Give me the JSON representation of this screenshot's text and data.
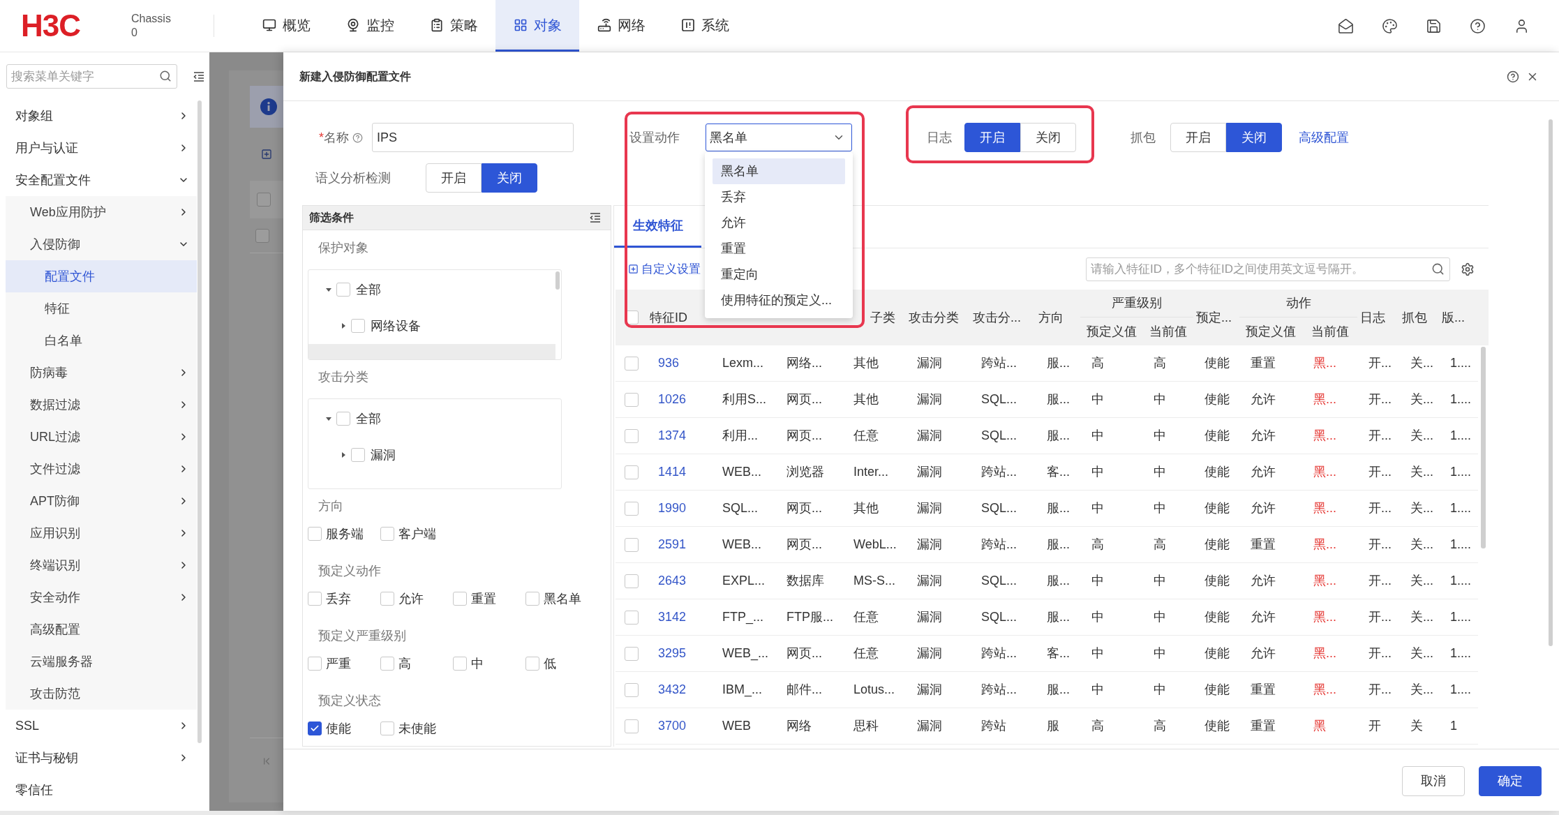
{
  "header": {
    "logo": "H3C",
    "device": {
      "name": "Chassis",
      "slot": "0"
    },
    "nav": [
      {
        "label": "概览",
        "selected": false
      },
      {
        "label": "监控",
        "selected": false
      },
      {
        "label": "策略",
        "selected": false
      },
      {
        "label": "对象",
        "selected": true
      },
      {
        "label": "网络",
        "selected": false
      },
      {
        "label": "系统",
        "selected": false
      }
    ]
  },
  "sidebar": {
    "search": {
      "placeholder": "搜索菜单关键字"
    },
    "items": [
      {
        "label": "对象组",
        "expanded": false,
        "selected": false
      },
      {
        "label": "用户与认证",
        "expanded": false,
        "selected": false
      },
      {
        "label": "安全配置文件",
        "expanded": true,
        "selected": false,
        "children": [
          {
            "label": "Web应用防护",
            "expanded": false,
            "selected": false
          },
          {
            "label": "入侵防御",
            "expanded": true,
            "selected": false,
            "children": [
              {
                "label": "配置文件",
                "selected": true
              },
              {
                "label": "特征",
                "selected": false
              },
              {
                "label": "白名单",
                "selected": false
              }
            ]
          },
          {
            "label": "防病毒",
            "expanded": false,
            "selected": false
          },
          {
            "label": "数据过滤",
            "expanded": false,
            "selected": false
          },
          {
            "label": "URL过滤",
            "expanded": false,
            "selected": false
          },
          {
            "label": "文件过滤",
            "expanded": false,
            "selected": false
          },
          {
            "label": "APT防御",
            "expanded": false,
            "selected": false
          },
          {
            "label": "应用识别",
            "expanded": false,
            "selected": false
          },
          {
            "label": "终端识别",
            "expanded": false,
            "selected": false
          },
          {
            "label": "安全动作",
            "expanded": false,
            "selected": false
          },
          {
            "label": "高级配置",
            "selected": false
          },
          {
            "label": "云端服务器",
            "selected": false
          },
          {
            "label": "攻击防范",
            "selected": false
          }
        ]
      },
      {
        "label": "SSL",
        "expanded": false,
        "selected": false
      },
      {
        "label": "证书与秘钥",
        "expanded": false,
        "selected": false
      },
      {
        "label": "零信任",
        "selected": false
      }
    ]
  },
  "background_page": {
    "rows": [
      {
        "checked": false
      },
      {
        "checked": false
      }
    ]
  },
  "dialog": {
    "title": "新建入侵防御配置文件",
    "name_field": {
      "required_mark": "*",
      "label": "名称",
      "value": "IPS"
    },
    "semantic_detection": {
      "label": "语义分析检测",
      "options": [
        {
          "label": "开启",
          "selected": false
        },
        {
          "label": "关闭",
          "selected": true
        }
      ]
    },
    "action_select": {
      "label": "设置动作",
      "value": "黑名单",
      "expanded": true,
      "options": [
        {
          "label": "黑名单",
          "selected": true
        },
        {
          "label": "丢弃",
          "selected": false
        },
        {
          "label": "允许",
          "selected": false
        },
        {
          "label": "重置",
          "selected": false
        },
        {
          "label": "重定向",
          "selected": false
        },
        {
          "label": "使用特征的预定义...",
          "selected": false
        }
      ]
    },
    "log": {
      "label": "日志",
      "options": [
        {
          "label": "开启",
          "selected": true
        },
        {
          "label": "关闭",
          "selected": false
        }
      ]
    },
    "capture": {
      "label": "抓包",
      "options": [
        {
          "label": "开启",
          "selected": false
        },
        {
          "label": "关闭",
          "selected": true
        }
      ]
    },
    "advanced_link": "高级配置",
    "filter_panel": {
      "title": "筛选条件",
      "sections": [
        {
          "kind": "tree",
          "label": "保护对象",
          "scrollable": true,
          "nodes": [
            {
              "label": "全部",
              "checked": false,
              "expanded": true,
              "children": [
                {
                  "label": "网络设备",
                  "checked": false,
                  "expanded": false
                }
              ]
            }
          ]
        },
        {
          "kind": "tree",
          "label": "攻击分类",
          "nodes": [
            {
              "label": "全部",
              "checked": false,
              "expanded": true,
              "children": [
                {
                  "label": "漏洞",
                  "checked": false,
                  "expanded": false
                }
              ]
            }
          ]
        },
        {
          "kind": "options",
          "label": "方向",
          "options": [
            {
              "label": "服务端",
              "checked": false
            },
            {
              "label": "客户端",
              "checked": false
            }
          ]
        },
        {
          "kind": "options",
          "label": "预定义动作",
          "options": [
            {
              "label": "丢弃",
              "checked": false
            },
            {
              "label": "允许",
              "checked": false
            },
            {
              "label": "重置",
              "checked": false
            },
            {
              "label": "黑名单",
              "checked": false
            }
          ]
        },
        {
          "kind": "options",
          "label": "预定义严重级别",
          "options": [
            {
              "label": "严重",
              "checked": false
            },
            {
              "label": "高",
              "checked": false
            },
            {
              "label": "中",
              "checked": false
            },
            {
              "label": "低",
              "checked": false
            }
          ]
        },
        {
          "kind": "options",
          "label": "预定义状态",
          "options": [
            {
              "label": "使能",
              "checked": true
            },
            {
              "label": "未使能",
              "checked": false
            }
          ]
        }
      ]
    },
    "signatures": {
      "tabs": [
        {
          "label": "生效特征",
          "selected": true
        }
      ],
      "custom_button": "自定义设置",
      "search": {
        "placeholder": "请输入特征ID，多个特征ID之间使用英文逗号隔开。"
      },
      "table": {
        "header_checked": false,
        "columns": [
          {
            "label": "特征ID",
            "kind": "link"
          },
          {
            "kind": "text"
          },
          {
            "kind": "text"
          },
          {
            "label": "子类",
            "kind": "text",
            "cut_off": true
          },
          {
            "label": "攻击分类",
            "kind": "text"
          },
          {
            "label": "攻击分...",
            "kind": "text"
          },
          {
            "label": "方向",
            "kind": "text"
          },
          {
            "label": "预定义值",
            "kind": "text",
            "group": "严重级别"
          },
          {
            "label": "当前值",
            "kind": "text",
            "in_group": true
          },
          {
            "label": "预定...",
            "kind": "text"
          },
          {
            "label": "预定义值",
            "kind": "text",
            "group": "动作"
          },
          {
            "label": "当前值",
            "kind": "alert",
            "in_group": true
          },
          {
            "label": "日志",
            "kind": "text"
          },
          {
            "label": "抓包",
            "kind": "text"
          },
          {
            "label": "版...",
            "kind": "text"
          }
        ],
        "rows": [
          {
            "checked": false,
            "cells": [
              "936",
              "Lexm...",
              "网络...",
              "其他",
              "漏洞",
              "跨站...",
              "服...",
              "高",
              "高",
              "使能",
              "重置",
              "黑...",
              "开...",
              "关...",
              "1...."
            ]
          },
          {
            "checked": false,
            "cells": [
              "1026",
              "利用S...",
              "网页...",
              "其他",
              "漏洞",
              "SQL...",
              "服...",
              "中",
              "中",
              "使能",
              "允许",
              "黑...",
              "开...",
              "关...",
              "1...."
            ]
          },
          {
            "checked": false,
            "cells": [
              "1374",
              "利用...",
              "网页...",
              "任意",
              "漏洞",
              "SQL...",
              "服...",
              "中",
              "中",
              "使能",
              "允许",
              "黑...",
              "开...",
              "关...",
              "1...."
            ]
          },
          {
            "checked": false,
            "cells": [
              "1414",
              "WEB...",
              "浏览器",
              "Inter...",
              "漏洞",
              "跨站...",
              "客...",
              "中",
              "中",
              "使能",
              "允许",
              "黑...",
              "开...",
              "关...",
              "1...."
            ]
          },
          {
            "checked": false,
            "cells": [
              "1990",
              "SQL...",
              "网页...",
              "其他",
              "漏洞",
              "SQL...",
              "服...",
              "中",
              "中",
              "使能",
              "允许",
              "黑...",
              "开...",
              "关...",
              "1...."
            ]
          },
          {
            "checked": false,
            "cells": [
              "2591",
              "WEB...",
              "网页...",
              "WebL...",
              "漏洞",
              "跨站...",
              "服...",
              "高",
              "高",
              "使能",
              "重置",
              "黑...",
              "开...",
              "关...",
              "1...."
            ]
          },
          {
            "checked": false,
            "cells": [
              "2643",
              "EXPL...",
              "数据库",
              "MS-S...",
              "漏洞",
              "SQL...",
              "服...",
              "中",
              "中",
              "使能",
              "允许",
              "黑...",
              "开...",
              "关...",
              "1...."
            ]
          },
          {
            "checked": false,
            "cells": [
              "3142",
              "FTP_...",
              "FTP服...",
              "任意",
              "漏洞",
              "SQL...",
              "服...",
              "中",
              "中",
              "使能",
              "允许",
              "黑...",
              "开...",
              "关...",
              "1...."
            ]
          },
          {
            "checked": false,
            "cells": [
              "3295",
              "WEB_...",
              "网页...",
              "任意",
              "漏洞",
              "跨站...",
              "客...",
              "中",
              "中",
              "使能",
              "允许",
              "黑...",
              "开...",
              "关...",
              "1...."
            ]
          },
          {
            "checked": false,
            "cells": [
              "3432",
              "IBM_...",
              "邮件...",
              "Lotus...",
              "漏洞",
              "跨站...",
              "服...",
              "中",
              "中",
              "使能",
              "重置",
              "黑...",
              "开...",
              "关...",
              "1...."
            ]
          },
          {
            "checked": false,
            "cells": [
              "3700",
              "WEB",
              "网络",
              "思科",
              "漏洞",
              "跨站",
              "服",
              "高",
              "高",
              "使能",
              "重置",
              "黑",
              "开",
              "关",
              "1"
            ]
          }
        ]
      }
    },
    "buttons": [
      {
        "label": "取消",
        "kind": "secondary"
      },
      {
        "label": "确定",
        "kind": "primary"
      }
    ]
  }
}
